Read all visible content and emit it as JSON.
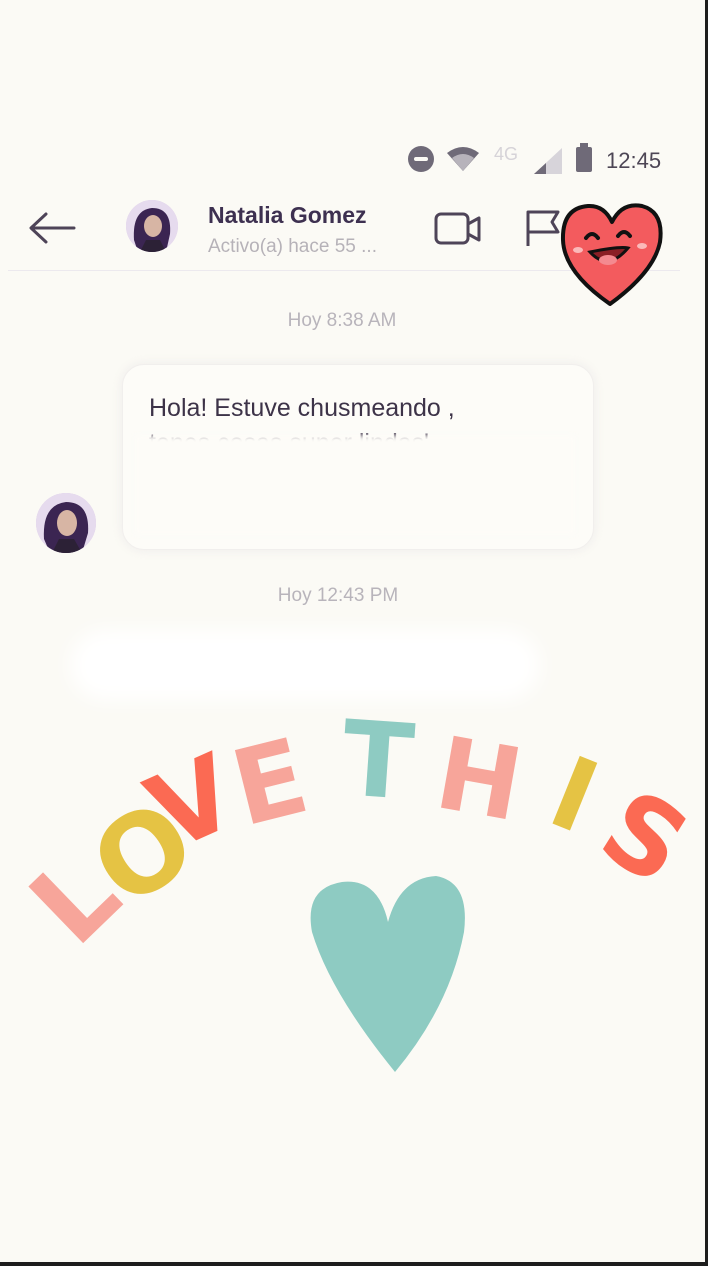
{
  "status_bar": {
    "network": "4G",
    "time": "12:45",
    "icons": [
      "do-not-disturb-icon",
      "wifi-icon",
      "signal-icon",
      "battery-icon"
    ]
  },
  "header": {
    "contact_name": "Natalia Gomez",
    "contact_status": "Activo(a) hace 55 ...",
    "icons": [
      "back-arrow-icon",
      "video-call-icon",
      "flag-icon",
      "info-icon"
    ]
  },
  "messages": [
    {
      "timestamp": "Hoy 8:38 AM",
      "lines": [
        "Hola! Estuve chusmeando ,",
        "tenes cosas super lindas'"
      ]
    },
    {
      "timestamp": "Hoy 12:43 PM"
    }
  ],
  "sticker": {
    "letters": [
      "L",
      "O",
      "V",
      "E",
      "T",
      "H",
      "I",
      "S"
    ],
    "colors": {
      "pink": "#f7a59a",
      "yellow": "#e5c344",
      "coral": "#fb6a53",
      "teal": "#8ecbc2"
    }
  },
  "colors": {
    "background": "#fbfaf5",
    "accent": "#3d3050",
    "muted": "#b8b4bb"
  }
}
